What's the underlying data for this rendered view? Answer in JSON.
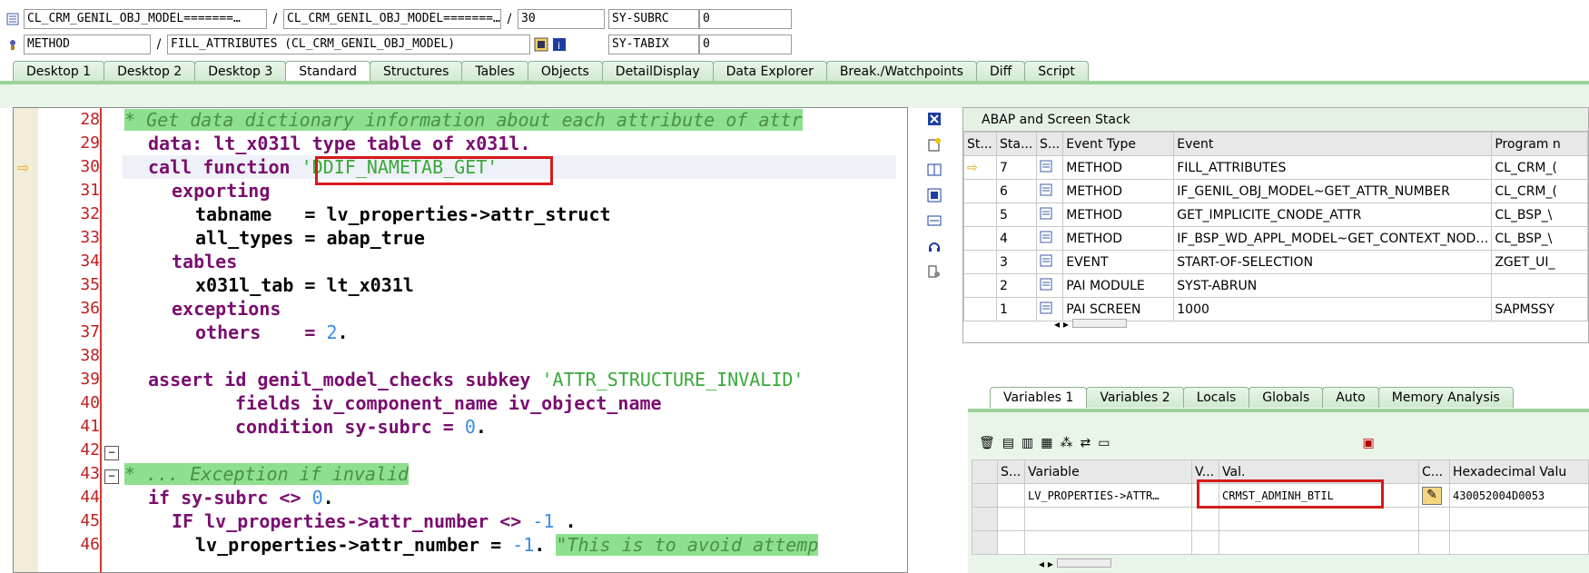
{
  "header": {
    "row1": {
      "field1": "CL_CRM_GENIL_OBJ_MODEL=======…",
      "sep1": "/",
      "field2": "CL_CRM_GENIL_OBJ_MODEL=======…",
      "sep2": "/",
      "line": "30",
      "sysvar": "SY-SUBRC",
      "sysval": "0"
    },
    "row2": {
      "field1": "METHOD",
      "sep1": "/",
      "field2": "FILL_ATTRIBUTES (CL_CRM_GENIL_OBJ_MODEL)",
      "sysvar": "SY-TABIX",
      "sysval": "0"
    }
  },
  "tabs": [
    "Desktop 1",
    "Desktop 2",
    "Desktop 3",
    "Standard",
    "Structures",
    "Tables",
    "Objects",
    "DetailDisplay",
    "Data Explorer",
    "Break./Watchpoints",
    "Diff",
    "Script"
  ],
  "active_tab": "Standard",
  "editor": {
    "lines": [
      {
        "n": "28"
      },
      {
        "n": "29"
      },
      {
        "n": "30"
      },
      {
        "n": "31"
      },
      {
        "n": "32"
      },
      {
        "n": "33"
      },
      {
        "n": "34"
      },
      {
        "n": "35"
      },
      {
        "n": "36"
      },
      {
        "n": "37"
      },
      {
        "n": "38"
      },
      {
        "n": "39"
      },
      {
        "n": "40"
      },
      {
        "n": "41"
      },
      {
        "n": "42"
      },
      {
        "n": "43"
      },
      {
        "n": "44"
      },
      {
        "n": "45"
      },
      {
        "n": "46"
      }
    ],
    "code": {
      "l28": "* Get data dictionary information about each attribute of attr",
      "l29a": "data: ",
      "l29b": "lt_x031l type table of x031l.",
      "l30a": "call function ",
      "l30b": "'DDIF_NAMETAB_GET'",
      "l31": "exporting",
      "l32": "tabname   = lv_properties->attr_struct",
      "l33": "all_types = abap_true",
      "l34": "tables",
      "l35": "x031l_tab = lt_x031l",
      "l36": "exceptions",
      "l37a": "others    = ",
      "l37b": "2",
      "l37c": ".",
      "l39a": "assert id genil_model_checks subkey ",
      "l39b": "'ATTR_STRUCTURE_INVALID'",
      "l40": "fields iv_component_name iv_object_name",
      "l41a": "condition sy-subrc = ",
      "l41b": "0",
      "l41c": ".",
      "l43": "* ... Exception if invalid",
      "l44a": "if sy-subrc <> ",
      "l44b": "0",
      "l44c": ".",
      "l45a": "IF lv_properties->attr_number <> ",
      "l45b": "-1",
      "l45c": " .",
      "l46a": "lv_properties->attr_number = ",
      "l46b": "-1",
      "l46c": ". ",
      "l46d": "\"This is to avoid attemp"
    }
  },
  "stack": {
    "title": "ABAP and Screen Stack",
    "columns": [
      "St...",
      "Sta...",
      "S...",
      "Event Type",
      "Event",
      "Program n"
    ],
    "rows": [
      {
        "level": "7",
        "type": "METHOD",
        "event": "FILL_ATTRIBUTES",
        "program": "CL_CRM_("
      },
      {
        "level": "6",
        "type": "METHOD",
        "event": "IF_GENIL_OBJ_MODEL~GET_ATTR_NUMBER",
        "program": "CL_CRM_("
      },
      {
        "level": "5",
        "type": "METHOD",
        "event": "GET_IMPLICITE_CNODE_ATTR",
        "program": "CL_BSP_\\"
      },
      {
        "level": "4",
        "type": "METHOD",
        "event": "IF_BSP_WD_APPL_MODEL~GET_CONTEXT_NOD…",
        "program": "CL_BSP_\\"
      },
      {
        "level": "3",
        "type": "EVENT",
        "event": "START-OF-SELECTION",
        "program": "ZGET_UI_"
      },
      {
        "level": "2",
        "type": "PAI MODULE",
        "event": "SYST-ABRUN",
        "program": ""
      },
      {
        "level": "1",
        "type": "PAI SCREEN",
        "event": "1000",
        "program": "SAPMSSY"
      }
    ]
  },
  "var_tabs": [
    "Variables 1",
    "Variables 2",
    "Locals",
    "Globals",
    "Auto",
    "Memory Analysis"
  ],
  "vars": {
    "columns": [
      "S...",
      "Variable",
      "V...",
      "Val.",
      "C...",
      "Hexadecimal Valu"
    ],
    "row": {
      "variable": "LV_PROPERTIES->ATTR…",
      "value": "CRMST_ADMINH_BTIL",
      "hex": "430052004D0053"
    }
  },
  "colors": {
    "accent_green": "#9bd39b",
    "highlight_red": "#d61a1a",
    "keyword": "#7a0d6f",
    "string": "#3aa83a"
  }
}
